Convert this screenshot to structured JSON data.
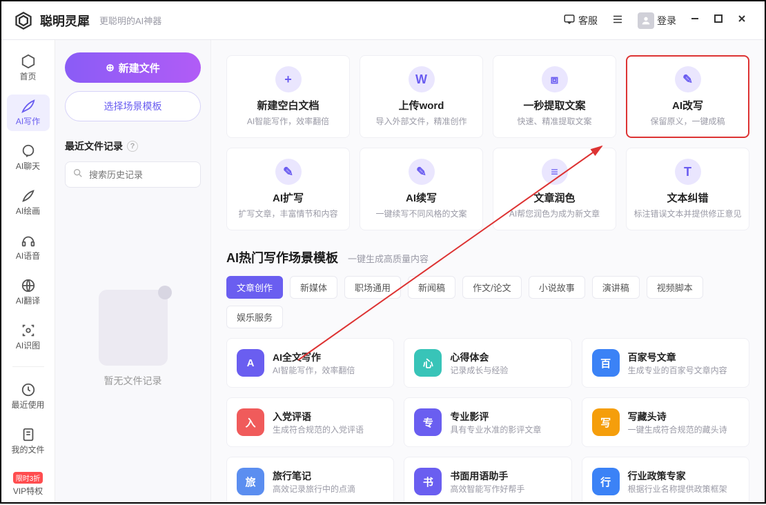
{
  "titlebar": {
    "app_name": "聪明灵犀",
    "tagline": "更聪明的AI神器",
    "support_label": "客服",
    "login_label": "登录"
  },
  "left_nav": {
    "items": [
      {
        "label": "首页"
      },
      {
        "label": "AI写作"
      },
      {
        "label": "AI聊天"
      },
      {
        "label": "AI绘画"
      },
      {
        "label": "AI语音"
      },
      {
        "label": "AI翻译"
      },
      {
        "label": "AI识图"
      }
    ],
    "secondary": [
      {
        "label": "最近使用"
      },
      {
        "label": "我的文件"
      }
    ],
    "vip_badge": "限时3折",
    "vip_label": "VIP特权"
  },
  "side_panel": {
    "new_file": "新建文件",
    "choose_template": "选择场景模板",
    "recent_title": "最近文件记录",
    "search_placeholder": "搜索历史记录",
    "empty_text": "暂无文件记录"
  },
  "cards": [
    {
      "title": "新建空白文档",
      "desc": "AI智能写作，效率翻倍"
    },
    {
      "title": "上传word",
      "desc": "导入外部文件，精准创作"
    },
    {
      "title": "一秒提取文案",
      "desc": "快速、精准提取文案"
    },
    {
      "title": "AI改写",
      "desc": "保留原义，一键成稿"
    },
    {
      "title": "AI扩写",
      "desc": "扩写文章，丰富情节和内容"
    },
    {
      "title": "AI续写",
      "desc": "一键续写不同风格的文案"
    },
    {
      "title": "文章润色",
      "desc": "AI帮您润色为成为新文章"
    },
    {
      "title": "文本纠错",
      "desc": "标注错误文本并提供修正意见"
    }
  ],
  "section": {
    "title": "AI热门写作场景模板",
    "subtitle": "一键生成高质量内容"
  },
  "tabs": [
    "文章创作",
    "新媒体",
    "职场通用",
    "新闻稿",
    "作文/论文",
    "小说故事",
    "演讲稿",
    "视频脚本",
    "娱乐服务"
  ],
  "templates": [
    {
      "title": "AI全文写作",
      "desc": "AI智能写作，效率翻倍",
      "color": "#6a5ef0"
    },
    {
      "title": "心得体会",
      "desc": "记录成长与经验",
      "color": "#38c4b8"
    },
    {
      "title": "百家号文章",
      "desc": "生成专业的百家号文章内容",
      "color": "#3b82f6"
    },
    {
      "title": "入党评语",
      "desc": "生成符合规范的入党评语",
      "color": "#f05b5b"
    },
    {
      "title": "专业影评",
      "desc": "具有专业水准的影评文章",
      "color": "#6a5ef0"
    },
    {
      "title": "写藏头诗",
      "desc": "一键生成符合规范的藏头诗",
      "color": "#f59e0b"
    },
    {
      "title": "旅行笔记",
      "desc": "高效记录旅行中的点滴",
      "color": "#5b8ef0"
    },
    {
      "title": "书面用语助手",
      "desc": "高效智能写作好帮手",
      "color": "#6a5ef0"
    },
    {
      "title": "行业政策专家",
      "desc": "根据行业名称提供政策框架",
      "color": "#3b82f6"
    }
  ]
}
